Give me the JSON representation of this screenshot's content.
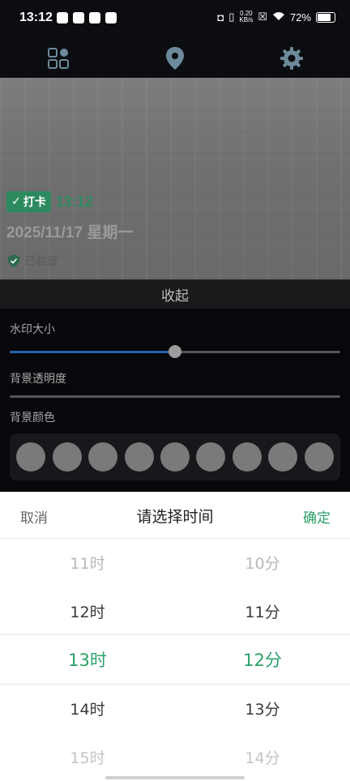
{
  "status_bar": {
    "time": "13:12",
    "net_speed_value": "0.20",
    "net_speed_unit": "KB/s",
    "battery": "72%"
  },
  "top_nav": {
    "icons": [
      "grid-apps-icon",
      "location-pin-icon",
      "gear-icon"
    ]
  },
  "watermark": {
    "punch_label": "打卡",
    "time": "13:12",
    "date": "2025/11/17 星期一",
    "verified": "已验证"
  },
  "collapse_label": "收起",
  "settings": {
    "size_label": "水印大小",
    "size_value": 0.5,
    "opacity_label": "背景透明度",
    "color_label": "背景颜色",
    "swatch_count": 9,
    "swatch_color": "#7a7a7a"
  },
  "picker": {
    "cancel": "取消",
    "title": "请选择时间",
    "confirm": "确定",
    "hours": [
      "11时",
      "12时",
      "13时",
      "14时",
      "15时"
    ],
    "minutes": [
      "10分",
      "11分",
      "12分",
      "13分",
      "14分"
    ],
    "selected_hour": "13时",
    "selected_minute": "12分",
    "accent": "#2aa06a"
  }
}
